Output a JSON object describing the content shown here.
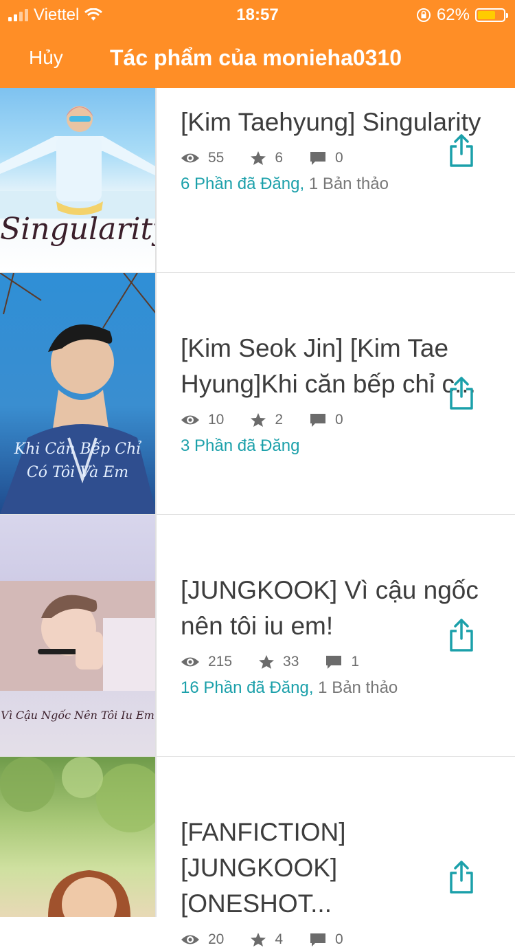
{
  "status": {
    "carrier": "Viettel",
    "time": "18:57",
    "battery": "62%",
    "battery_level": 0.62
  },
  "nav": {
    "cancel_label": "Hủy",
    "title": "Tác phẩm của monieha0310"
  },
  "works": [
    {
      "title_lines": [
        "[Kim Taehyung] Singularity"
      ],
      "views": "55",
      "votes": "6",
      "comments": "0",
      "published": "6 Phần đã Đăng,",
      "drafts": "1 Bản thảo",
      "cover_text": "Singularity"
    },
    {
      "title_lines": [
        "[Kim Seok Jin] [Kim Tae",
        "Hyung]Khi căn bếp chỉ c..."
      ],
      "views": "10",
      "votes": "2",
      "comments": "0",
      "published": "3 Phần đã Đăng",
      "drafts": "",
      "cover_text": "Khi Căn Bếp Chỉ Có Tôi Và Em"
    },
    {
      "title_lines": [
        "[JUNGKOOK] Vì cậu ngốc",
        "nên tôi iu em!"
      ],
      "views": "215",
      "votes": "33",
      "comments": "1",
      "published": "16 Phần đã Đăng,",
      "drafts": "1 Bản thảo",
      "cover_text": "Vì Cậu Ngốc Nên Tôi Iu Em"
    },
    {
      "title_lines": [
        "[FANFICTION]",
        "[JUNGKOOK] [ONESHOT..."
      ],
      "views": "20",
      "votes": "4",
      "comments": "0",
      "published": "",
      "drafts": "",
      "cover_text": ""
    }
  ],
  "icons": {
    "views": "eye-icon",
    "votes": "star-icon",
    "comments": "comment-icon",
    "share": "share-icon"
  },
  "colors": {
    "header": "#FF8E26",
    "accent": "#1BA0AA",
    "text": "#3d3d3d"
  }
}
